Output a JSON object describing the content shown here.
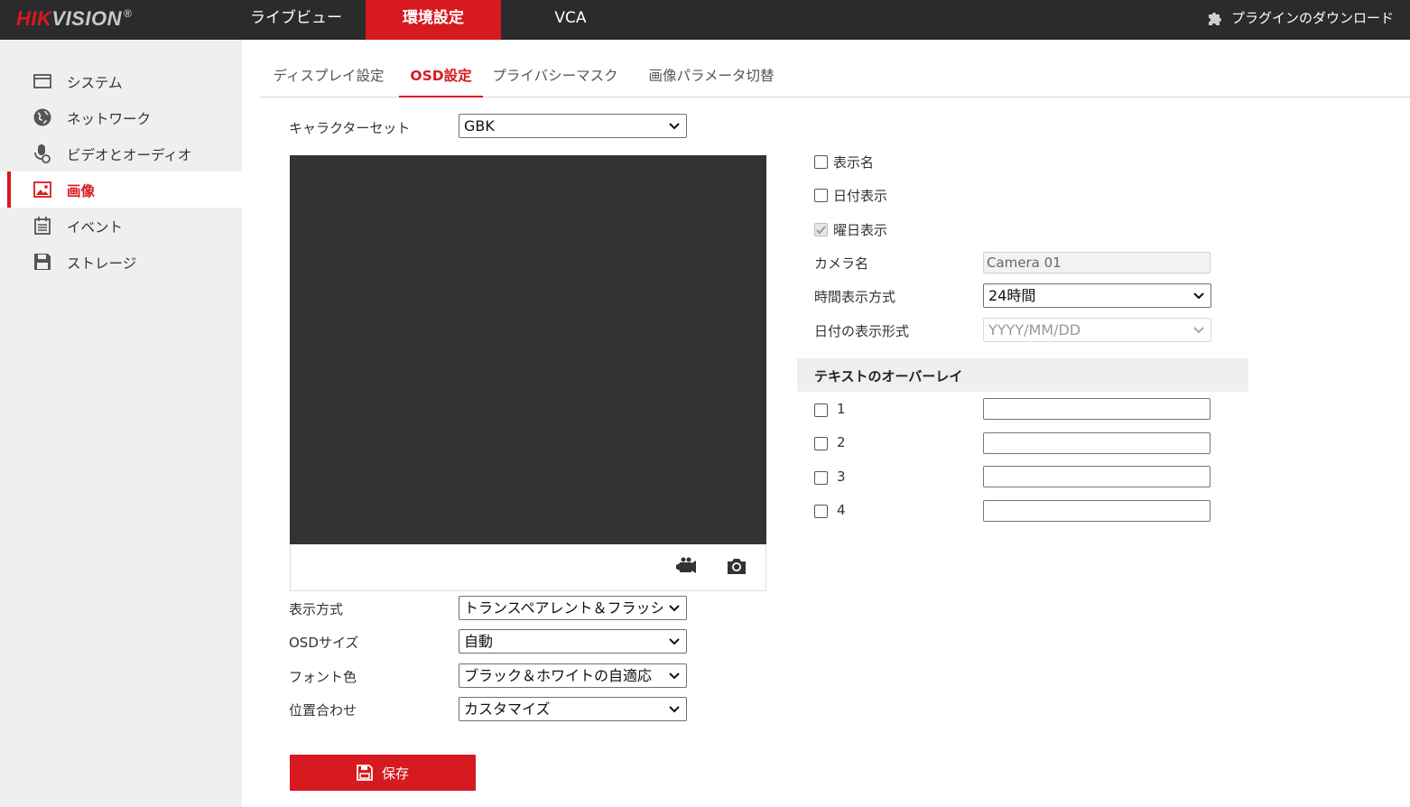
{
  "brand": {
    "name_hik": "HIK",
    "name_vision": "VISION",
    "reg": "®"
  },
  "nav": {
    "tabs": [
      {
        "label": "ライブビュー"
      },
      {
        "label": "環境設定",
        "active": true
      },
      {
        "label": "VCA"
      }
    ],
    "plugin_label": "プラグインのダウンロード"
  },
  "sidebar": {
    "items": [
      {
        "label": "システム",
        "icon": "monitor-icon"
      },
      {
        "label": "ネットワーク",
        "icon": "globe-icon"
      },
      {
        "label": "ビデオとオーディオ",
        "icon": "microphone-icon"
      },
      {
        "label": "画像",
        "icon": "image-icon",
        "active": true
      },
      {
        "label": "イベント",
        "icon": "calendar-icon"
      },
      {
        "label": "ストレージ",
        "icon": "floppy-disk-icon"
      }
    ]
  },
  "subtabs": [
    {
      "label": "ディスプレイ設定"
    },
    {
      "label": "OSD設定",
      "active": true
    },
    {
      "label": "プライバシーマスク"
    },
    {
      "label": "画像パラメータ切替"
    }
  ],
  "form_left": {
    "charset_label": "キャラクターセット",
    "charset_value": "GBK",
    "display_mode_label": "表示方式",
    "display_mode_value": "トランスペアレント＆フラッシング",
    "osd_size_label": "OSDサイズ",
    "osd_size_value": "自動",
    "font_color_label": "フォント色",
    "font_color_value": "ブラック＆ホワイトの自適応",
    "alignment_label": "位置合わせ",
    "alignment_value": "カスタマイズ"
  },
  "form_right": {
    "show_name_label": "表示名",
    "show_name_checked": false,
    "show_date_label": "日付表示",
    "show_date_checked": false,
    "show_week_label": "曜日表示",
    "show_week_checked": true,
    "camera_name_label": "カメラ名",
    "camera_name_value": "Camera 01",
    "time_format_label": "時間表示方式",
    "time_format_value": "24時間",
    "date_format_label": "日付の表示形式",
    "date_format_value": "YYYY/MM/DD"
  },
  "overlay": {
    "title": "テキストのオーバーレイ",
    "items": [
      {
        "label": "1",
        "checked": false,
        "value": ""
      },
      {
        "label": "2",
        "checked": false,
        "value": ""
      },
      {
        "label": "3",
        "checked": false,
        "value": ""
      },
      {
        "label": "4",
        "checked": false,
        "value": ""
      }
    ]
  },
  "save_label": "保存",
  "colors": {
    "accent": "#d71920",
    "topbar": "#2b2b2b",
    "sidebar": "#efefef",
    "video": "#333333"
  }
}
